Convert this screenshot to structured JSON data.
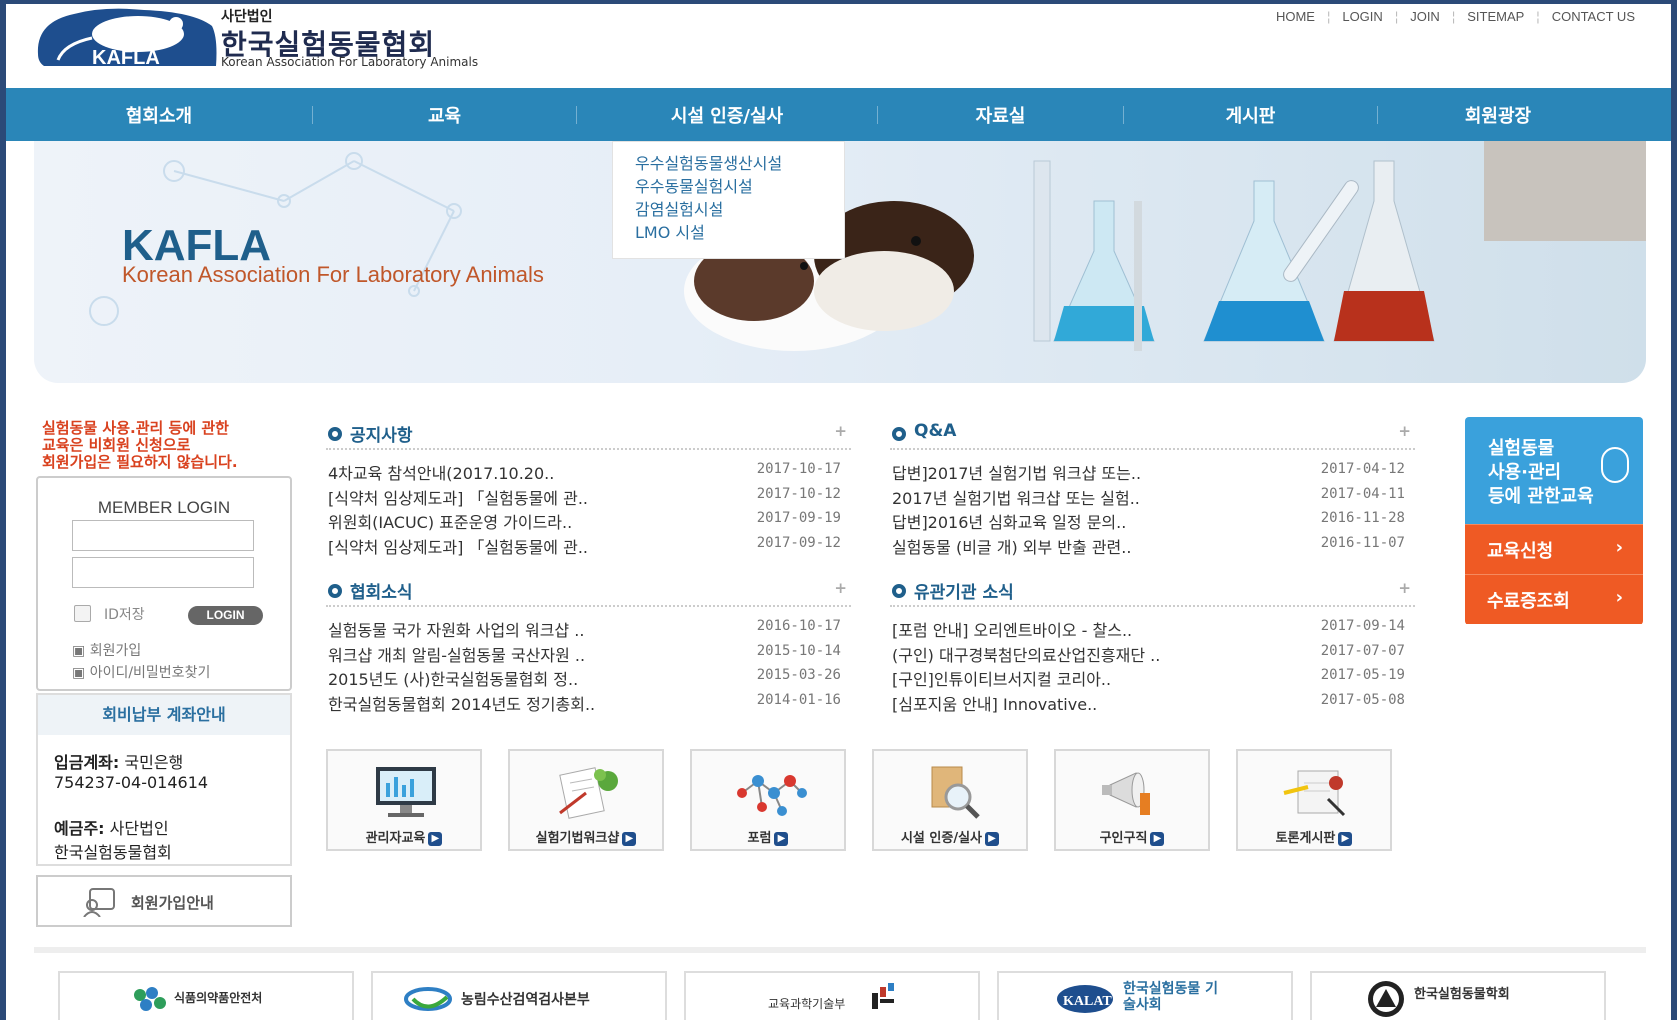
{
  "header": {
    "org_small": "사단법인",
    "org_name": "한국실험동물협회",
    "org_en": "Korean Association For Laboratory Animals",
    "logo_text": "KAFLA",
    "topnav": [
      "HOME",
      "LOGIN",
      "JOIN",
      "SITEMAP",
      "CONTACT US"
    ]
  },
  "mainnav": [
    "협회소개",
    "교육",
    "시설 인증/실사",
    "자료실",
    "게시판",
    "회원광장"
  ],
  "dropdown": [
    "우수실험동물생산시설",
    "우수동물실험시설",
    "감염실험시설",
    "LMO 시설"
  ],
  "banner": {
    "title": "KAFLA",
    "subtitle": "Korean Association For Laboratory Animals"
  },
  "left": {
    "notice_lines": [
      "실험동물 사용.관리 등에 관한",
      "교육은 비회원 신청으로",
      "회원가입은 필요하지 않습니다."
    ],
    "login_title": "MEMBER LOGIN",
    "save_id": "ID저장",
    "login_btn": "LOGIN",
    "join_link": "회원가입",
    "find_link": "아이디/비밀번호찾기",
    "bank_title": "회비납부 계좌안내",
    "bank_label": "입금계좌:",
    "bank_name": "국민은행",
    "bank_account": "754237-04-014614",
    "holder_label": "예금주:",
    "holder_1": "사단법인",
    "holder_2": "한국실험동물협회",
    "join_guide": "회원가입안내"
  },
  "boards": {
    "notice": {
      "title": "공지사항",
      "rows": [
        {
          "subject": "4차교육 참석안내(2017.10.20..",
          "date": "2017-10-17"
        },
        {
          "subject": "[식약처 임상제도과] 「실험동물에 관..",
          "date": "2017-10-12"
        },
        {
          "subject": "위원회(IACUC) 표준운영 가이드라..",
          "date": "2017-09-19"
        },
        {
          "subject": "[식약처 임상제도과] 「실험동물에 관..",
          "date": "2017-09-12"
        }
      ]
    },
    "qna": {
      "title": "Q&A",
      "rows": [
        {
          "subject": "답변]2017년 실험기법 워크샵 또는..",
          "date": "2017-04-12"
        },
        {
          "subject": "2017년 실험기법 워크샵 또는 실험..",
          "date": "2017-04-11"
        },
        {
          "subject": "답변]2016년 심화교육 일정 문의..",
          "date": "2016-11-28"
        },
        {
          "subject": "실험동물 (비글 개) 외부 반출 관련..",
          "date": "2016-11-07"
        }
      ]
    },
    "news": {
      "title": "협회소식",
      "rows": [
        {
          "subject": "실험동물 국가 자원화 사업의 워크샵 ..",
          "date": "2016-10-17"
        },
        {
          "subject": "워크샵 개최 알림-실험동물 국산자원 ..",
          "date": "2015-10-14"
        },
        {
          "subject": "2015년도 (사)한국실험동물협회 정..",
          "date": "2015-03-26"
        },
        {
          "subject": "한국실험동물협회 2014년도 정기총회..",
          "date": "2014-01-16"
        }
      ]
    },
    "related": {
      "title": "유관기관 소식",
      "rows": [
        {
          "subject": "[포럼 안내] 오리엔트바이오 - 찰스..",
          "date": "2017-09-14"
        },
        {
          "subject": "(구인) 대구경북첨단의료산업진흥재단 ..",
          "date": "2017-07-07"
        },
        {
          "subject": "[구인]인튜이티브서지컬 코리아..",
          "date": "2017-05-19"
        },
        {
          "subject": "[심포지움 안내] Innovative..",
          "date": "2017-05-08"
        }
      ]
    }
  },
  "edu_box": {
    "lines": [
      "실험동물",
      "사용·관리",
      "등에 관한교육"
    ],
    "apply": "교육신청",
    "certificate": "수료증조회"
  },
  "quick": [
    "관리자교육",
    "실험기법워크샵",
    "포럼",
    "시설 인증/실사",
    "구인구직",
    "토론게시판"
  ],
  "partners": [
    "식품의약품안전처",
    "농림수산검역검사본부",
    "교육과학기술부",
    "한국실험동물 기술사회",
    "한국실험동물학회"
  ],
  "colors": {
    "nav_blue": "#2a86b8",
    "title_blue": "#1f5f8b",
    "accent_orange": "#ef5a24",
    "edu_blue": "#3aa1dc",
    "notice_red": "#d9411e"
  }
}
